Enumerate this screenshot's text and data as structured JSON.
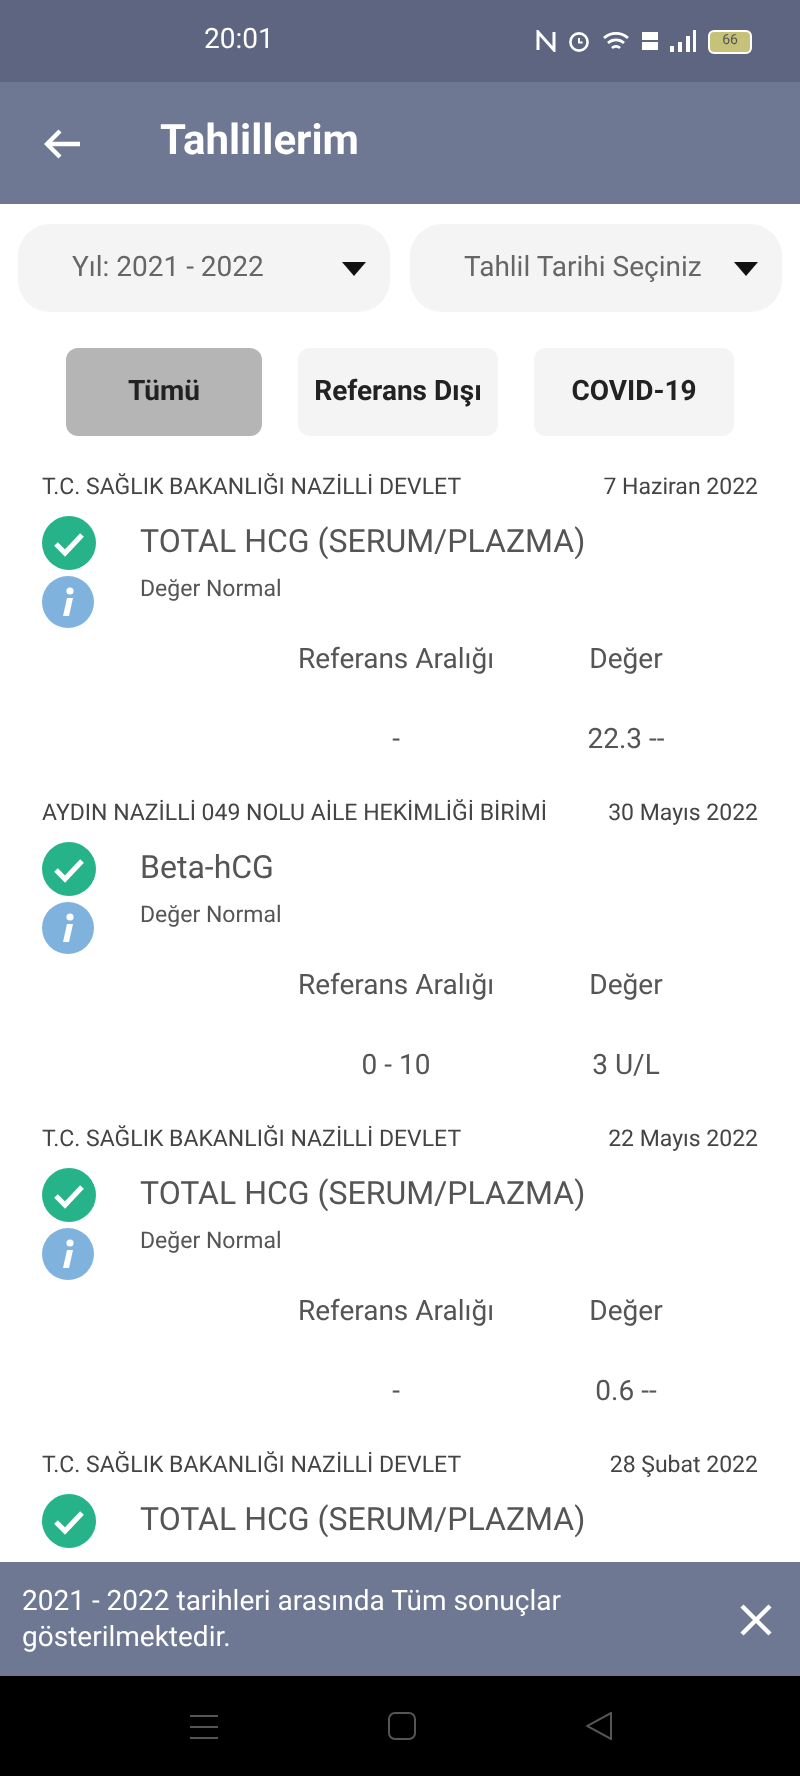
{
  "status_bar": {
    "time": "20:01",
    "battery": "66"
  },
  "app_bar": {
    "title": "Tahlillerim"
  },
  "dropdowns": [
    {
      "label": "Yıl: 2021 - 2022"
    },
    {
      "label": "Tahlil Tarihi Seçiniz"
    }
  ],
  "filters": [
    {
      "label": "Tümü",
      "selected": true
    },
    {
      "label": "Referans Dışı",
      "selected": false
    },
    {
      "label": "COVID-19",
      "selected": false
    }
  ],
  "results": [
    {
      "institution": "T.C. SAĞLIK BAKANLIĞI NAZİLLİ DEVLET",
      "date": "7 Haziran 2022",
      "test": "TOTAL HCG (SERUM/PLAZMA)",
      "checked": true,
      "status": "Değer Normal",
      "range_label": "Referans Aralığı",
      "value_label": "Değer",
      "range": "-",
      "value": "22.3 --"
    },
    {
      "institution": "AYDIN NAZİLLİ 049 NOLU AİLE HEKİMLİĞİ BİRİMİ",
      "date": "30 Mayıs 2022",
      "test": "Beta-hCG",
      "checked": true,
      "status": "Değer Normal",
      "range_label": "Referans Aralığı",
      "value_label": "Değer",
      "range": "0 - 10",
      "value": "3 U/L"
    },
    {
      "institution": "T.C. SAĞLIK BAKANLIĞI NAZİLLİ DEVLET",
      "date": "22 Mayıs 2022",
      "test": "TOTAL HCG (SERUM/PLAZMA)",
      "checked": true,
      "status": "Değer Normal",
      "range_label": "Referans Aralığı",
      "value_label": "Değer",
      "range": "-",
      "value": "0.6 --"
    },
    {
      "institution": "T.C. SAĞLIK BAKANLIĞI NAZİLLİ DEVLET",
      "date": "28 Şubat 2022",
      "test": "TOTAL HCG (SERUM/PLAZMA)",
      "checked": true
    }
  ],
  "snackbar": {
    "message": "2021 - 2022 tarihleri arasında Tüm sonuçlar gösterilmektedir."
  }
}
